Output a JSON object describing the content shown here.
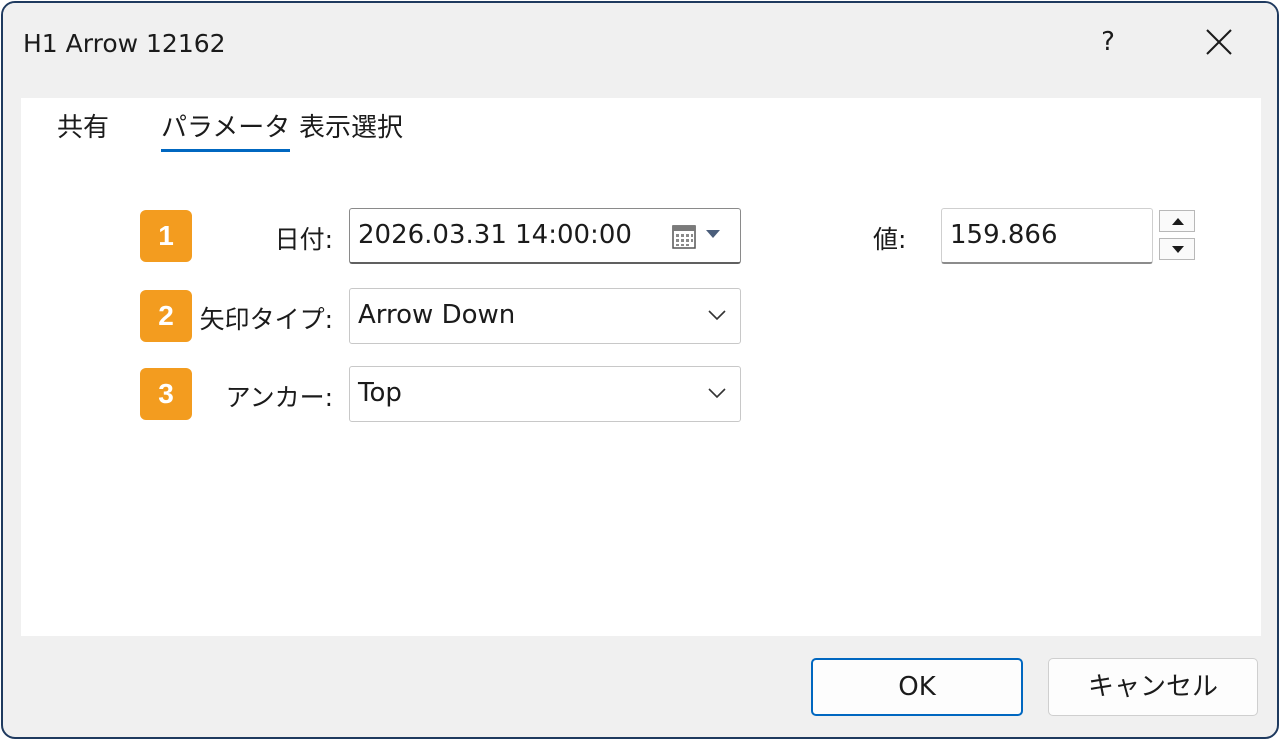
{
  "window": {
    "title": "H1 Arrow 12162",
    "help_label": "?"
  },
  "tabs": [
    {
      "label": "共有",
      "active": false
    },
    {
      "label": "パラメータ",
      "active": true
    },
    {
      "label": "表示選択",
      "active": false
    }
  ],
  "form": {
    "date": {
      "badge": "1",
      "label": "日付:",
      "value": "2026.03.31 14:00:00"
    },
    "value": {
      "label": "値:",
      "value": "159.866"
    },
    "arrow_type": {
      "badge": "2",
      "label": "矢印タイプ:",
      "selected": "Arrow Down"
    },
    "anchor": {
      "badge": "3",
      "label": "アンカー:",
      "selected": "Top"
    }
  },
  "buttons": {
    "ok": "OK",
    "cancel": "キャンセル"
  },
  "colors": {
    "accent": "#0067c0",
    "badge": "#f39c1f",
    "window_border": "#1f3a5f"
  }
}
